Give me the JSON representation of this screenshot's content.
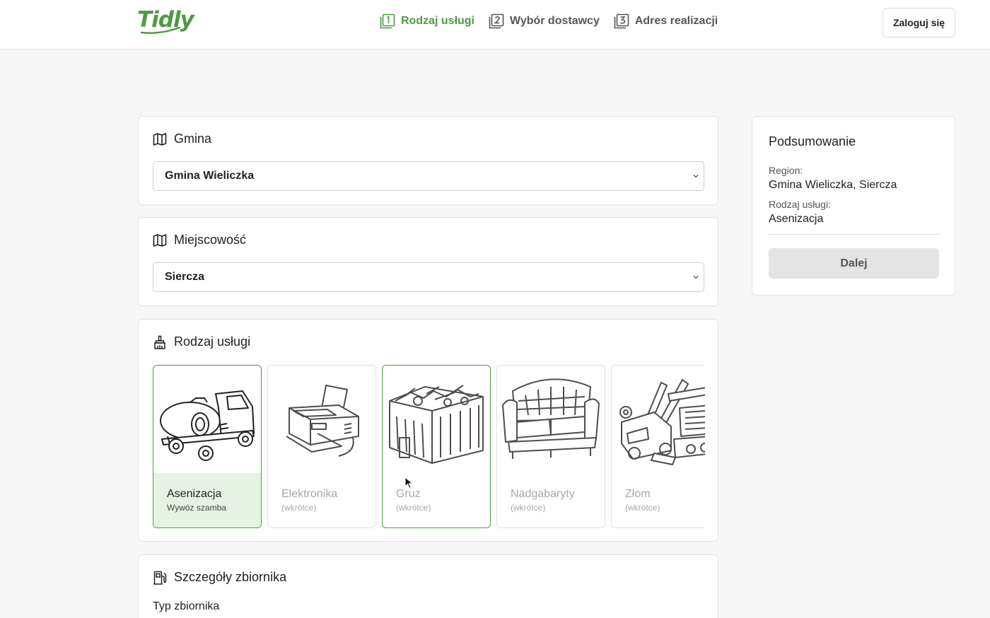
{
  "header": {
    "logo": "Tidly",
    "steps": [
      {
        "num": "1",
        "label": "Rodzaj usługi"
      },
      {
        "num": "2",
        "label": "Wybór dostawcy"
      },
      {
        "num": "3",
        "label": "Adres realizacji"
      }
    ],
    "login_label": "Zaloguj się"
  },
  "gmina": {
    "title": "Gmina",
    "value": "Gmina Wieliczka"
  },
  "miejscowosc": {
    "title": "Miejscowość",
    "value": "Siercza"
  },
  "service_type": {
    "title": "Rodzaj usługi",
    "items": [
      {
        "name": "Asenizacja",
        "sub": "Wywóz szamba",
        "icon": "septic-truck-icon"
      },
      {
        "name": "Elektronika",
        "sub": "(wkrótce)",
        "icon": "printer-icon"
      },
      {
        "name": "Gruz",
        "sub": "(wkrótce)",
        "icon": "rubble-container-icon"
      },
      {
        "name": "Nadgabaryty",
        "sub": "(wkrótce)",
        "icon": "sofa-icon"
      },
      {
        "name": "Złom",
        "sub": "(wkrótce)",
        "icon": "scrap-metal-icon"
      }
    ]
  },
  "tank": {
    "title": "Szczegóły zbiornika",
    "type_label": "Typ zbiornika"
  },
  "summary": {
    "title": "Podsumowanie",
    "region_label": "Region:",
    "region_value": "Gmina Wieliczka, Siercza",
    "service_label": "Rodzaj usługi:",
    "service_value": "Asenizacja",
    "next_label": "Dalej"
  },
  "colors": {
    "brand": "#4f9a45",
    "selected_bg": "#e5f3e3",
    "page_bg": "#f7f7f7"
  }
}
